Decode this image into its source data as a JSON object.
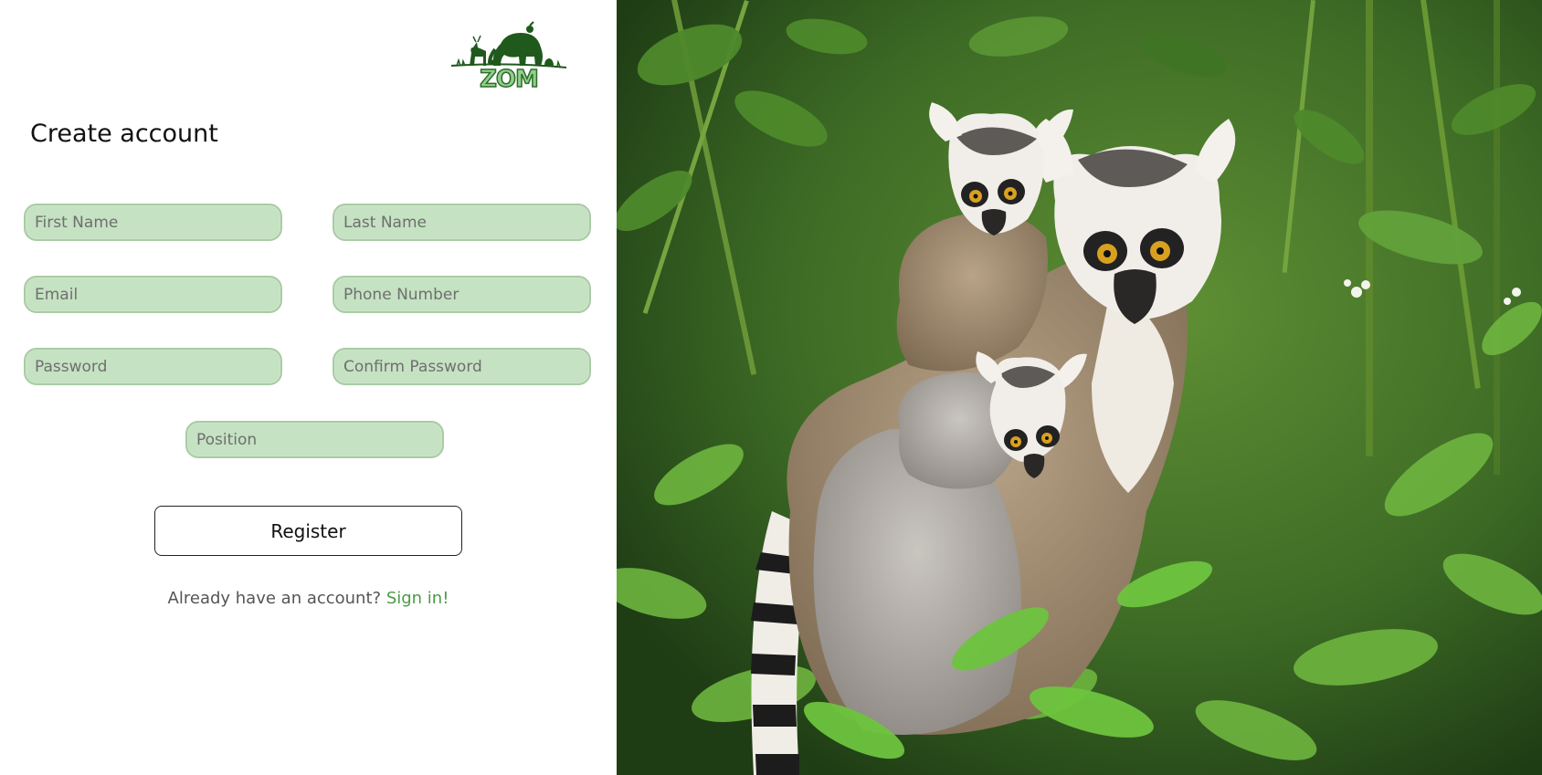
{
  "brand": {
    "logo_text": "ZOM"
  },
  "form": {
    "title": "Create account",
    "fields": {
      "first_name": {
        "placeholder": "First Name",
        "value": ""
      },
      "last_name": {
        "placeholder": "Last Name",
        "value": ""
      },
      "email": {
        "placeholder": "Email",
        "value": ""
      },
      "phone": {
        "placeholder": "Phone Number",
        "value": ""
      },
      "password": {
        "placeholder": "Password",
        "value": ""
      },
      "confirm_password": {
        "placeholder": "Confirm Password",
        "value": ""
      },
      "position": {
        "placeholder": "Position",
        "value": ""
      }
    },
    "register_label": "Register",
    "signin_prompt": "Already have an account?",
    "signin_link": "Sign in!"
  },
  "colors": {
    "field_fill": "#c5e2c2",
    "field_border": "#a9cba5",
    "link": "#4a9b46",
    "logo_dark": "#1f5a1c",
    "logo_light": "#8fd08a"
  },
  "hero_image": {
    "subject": "ring-tailed lemurs in green foliage"
  }
}
